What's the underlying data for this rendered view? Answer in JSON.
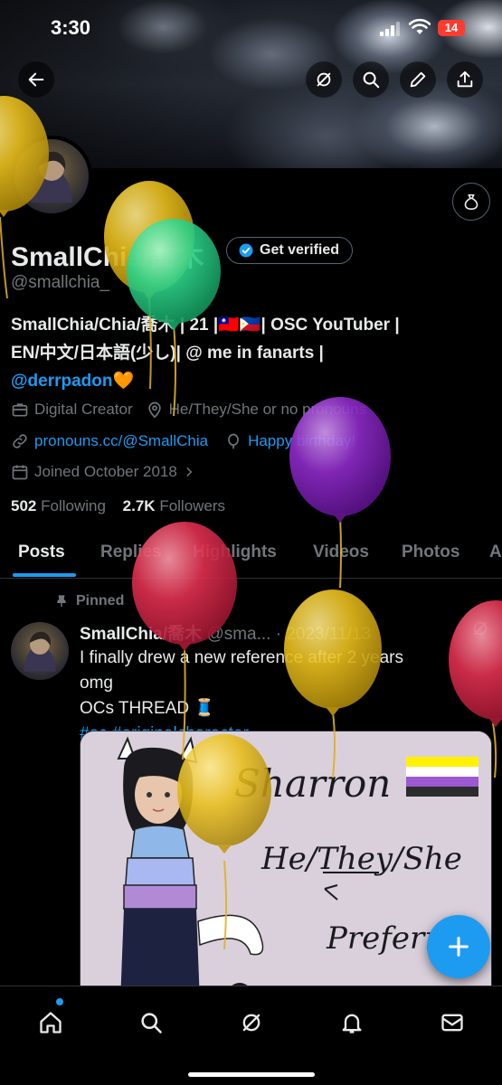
{
  "status_bar": {
    "time": "3:30",
    "battery": "14"
  },
  "header": {
    "back_icon": "arrow-left-icon",
    "grok_icon": "grok-icon",
    "search_icon": "search-icon",
    "edit_icon": "pencil-icon",
    "share_icon": "share-icon"
  },
  "profile": {
    "display_name": "SmallChia/喬木",
    "verified_label": "Get verified",
    "handle": "@smallchia_",
    "bio_line1": "SmallChia/Chia/喬木 | 21 |🇹🇼🇵🇭| OSC YouTuber |",
    "bio_line2": "EN/中文/日本語(少し)| @ me in fanarts |",
    "bio_mention": "@derrpadon",
    "bio_emoji": "🧡",
    "category": "Digital Creator",
    "location": "He/They/She or no pronouns",
    "website": "pronouns.cc/@SmallChia",
    "birthday": "Happy birthday!",
    "joined": "Joined October 2018",
    "following_count": "502",
    "following_label": "Following",
    "followers_count": "2.7K",
    "followers_label": "Followers"
  },
  "tabs": [
    "Posts",
    "Replies",
    "Highlights",
    "Videos",
    "Photos",
    "A"
  ],
  "pinned_post": {
    "pinned_label": "Pinned",
    "author": "SmallChia/喬木",
    "handle": "@sma...",
    "date": "· 2023/11/13",
    "text_line1": "I finally drew a new reference after 2 years",
    "text_line2": "omg",
    "text_line3": "OCs THREAD 🧵",
    "hashtags": "#oc #originalcharacter",
    "image_text_name": "Sharron",
    "image_text_pronouns": "He/They/She",
    "image_text_pref": "Preferr"
  },
  "bottom_nav": [
    "home-icon",
    "search-icon",
    "grok-icon",
    "bell-icon",
    "mail-icon"
  ],
  "colors": {
    "accent": "#1d9bf0",
    "muted": "#71767b",
    "text": "#e7e9ea",
    "background": "#000000"
  }
}
